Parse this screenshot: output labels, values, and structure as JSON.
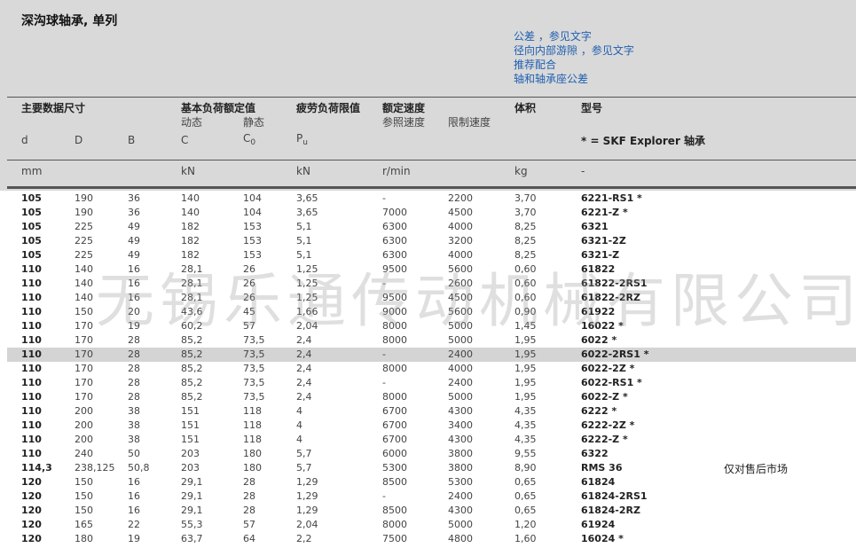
{
  "title": "深沟球轴承, 单列",
  "links": [
    "公差 ，参见文字",
    "径向内部游隙 ，参见文字",
    "推荐配合",
    "轴和轴承座公差"
  ],
  "header": {
    "main_dims": "主要数据尺寸",
    "load_ratings": "基本负荷额定值",
    "dynamic": "动态",
    "static": "静态",
    "fatigue": "疲劳负荷限值",
    "speed_ratings": "额定速度",
    "ref_speed": "参照速度",
    "limit_speed": "限制速度",
    "mass": "体积",
    "designation": "型号",
    "sym_d": "d",
    "sym_D": "D",
    "sym_B": "B",
    "sym_C": "C",
    "sym_C0_base": "C",
    "sym_C0_sub": "0",
    "sym_Pu_base": "P",
    "sym_Pu_sub": "u",
    "explorer_note": "* = SKF Explorer 轴承",
    "unit_mm": "mm",
    "unit_kN_C": "kN",
    "unit_kN_P": "kN",
    "unit_rpm": "r/min",
    "unit_kg": "kg",
    "unit_dash": "-"
  },
  "rows": [
    {
      "d": "105",
      "D": "190",
      "B": "36",
      "C": "140",
      "C0": "104",
      "Pu": "3,65",
      "ref": "-",
      "lim": "2200",
      "mass": "3,70",
      "model": "6221-RS1 *"
    },
    {
      "d": "105",
      "D": "190",
      "B": "36",
      "C": "140",
      "C0": "104",
      "Pu": "3,65",
      "ref": "7000",
      "lim": "4500",
      "mass": "3,70",
      "model": "6221-Z *"
    },
    {
      "d": "105",
      "D": "225",
      "B": "49",
      "C": "182",
      "C0": "153",
      "Pu": "5,1",
      "ref": "6300",
      "lim": "4000",
      "mass": "8,25",
      "model": "6321"
    },
    {
      "d": "105",
      "D": "225",
      "B": "49",
      "C": "182",
      "C0": "153",
      "Pu": "5,1",
      "ref": "6300",
      "lim": "3200",
      "mass": "8,25",
      "model": "6321-2Z"
    },
    {
      "d": "105",
      "D": "225",
      "B": "49",
      "C": "182",
      "C0": "153",
      "Pu": "5,1",
      "ref": "6300",
      "lim": "4000",
      "mass": "8,25",
      "model": "6321-Z"
    },
    {
      "d": "110",
      "D": "140",
      "B": "16",
      "C": "28,1",
      "C0": "26",
      "Pu": "1,25",
      "ref": "9500",
      "lim": "5600",
      "mass": "0,60",
      "model": "61822"
    },
    {
      "d": "110",
      "D": "140",
      "B": "16",
      "C": "28,1",
      "C0": "26",
      "Pu": "1,25",
      "ref": "-",
      "lim": "2600",
      "mass": "0,60",
      "model": "61822-2RS1"
    },
    {
      "d": "110",
      "D": "140",
      "B": "16",
      "C": "28,1",
      "C0": "26",
      "Pu": "1,25",
      "ref": "9500",
      "lim": "4500",
      "mass": "0,60",
      "model": "61822-2RZ"
    },
    {
      "d": "110",
      "D": "150",
      "B": "20",
      "C": "43,6",
      "C0": "45",
      "Pu": "1,66",
      "ref": "9000",
      "lim": "5600",
      "mass": "0,90",
      "model": "61922"
    },
    {
      "d": "110",
      "D": "170",
      "B": "19",
      "C": "60,2",
      "C0": "57",
      "Pu": "2,04",
      "ref": "8000",
      "lim": "5000",
      "mass": "1,45",
      "model": "16022 *"
    },
    {
      "d": "110",
      "D": "170",
      "B": "28",
      "C": "85,2",
      "C0": "73,5",
      "Pu": "2,4",
      "ref": "8000",
      "lim": "5000",
      "mass": "1,95",
      "model": "6022 *"
    },
    {
      "d": "110",
      "D": "170",
      "B": "28",
      "C": "85,2",
      "C0": "73,5",
      "Pu": "2,4",
      "ref": "-",
      "lim": "2400",
      "mass": "1,95",
      "model": "6022-2RS1 *",
      "highlight": true
    },
    {
      "d": "110",
      "D": "170",
      "B": "28",
      "C": "85,2",
      "C0": "73,5",
      "Pu": "2,4",
      "ref": "8000",
      "lim": "4000",
      "mass": "1,95",
      "model": "6022-2Z *"
    },
    {
      "d": "110",
      "D": "170",
      "B": "28",
      "C": "85,2",
      "C0": "73,5",
      "Pu": "2,4",
      "ref": "-",
      "lim": "2400",
      "mass": "1,95",
      "model": "6022-RS1 *"
    },
    {
      "d": "110",
      "D": "170",
      "B": "28",
      "C": "85,2",
      "C0": "73,5",
      "Pu": "2,4",
      "ref": "8000",
      "lim": "5000",
      "mass": "1,95",
      "model": "6022-Z *"
    },
    {
      "d": "110",
      "D": "200",
      "B": "38",
      "C": "151",
      "C0": "118",
      "Pu": "4",
      "ref": "6700",
      "lim": "4300",
      "mass": "4,35",
      "model": "6222 *"
    },
    {
      "d": "110",
      "D": "200",
      "B": "38",
      "C": "151",
      "C0": "118",
      "Pu": "4",
      "ref": "6700",
      "lim": "3400",
      "mass": "4,35",
      "model": "6222-2Z *"
    },
    {
      "d": "110",
      "D": "200",
      "B": "38",
      "C": "151",
      "C0": "118",
      "Pu": "4",
      "ref": "6700",
      "lim": "4300",
      "mass": "4,35",
      "model": "6222-Z *"
    },
    {
      "d": "110",
      "D": "240",
      "B": "50",
      "C": "203",
      "C0": "180",
      "Pu": "5,7",
      "ref": "6000",
      "lim": "3800",
      "mass": "9,55",
      "model": "6322"
    },
    {
      "d": "114,3",
      "D": "238,125",
      "B": "50,8",
      "C": "203",
      "C0": "180",
      "Pu": "5,7",
      "ref": "5300",
      "lim": "3800",
      "mass": "8,90",
      "model": "RMS 36"
    },
    {
      "d": "120",
      "D": "150",
      "B": "16",
      "C": "29,1",
      "C0": "28",
      "Pu": "1,29",
      "ref": "8500",
      "lim": "5300",
      "mass": "0,65",
      "model": "61824"
    },
    {
      "d": "120",
      "D": "150",
      "B": "16",
      "C": "29,1",
      "C0": "28",
      "Pu": "1,29",
      "ref": "-",
      "lim": "2400",
      "mass": "0,65",
      "model": "61824-2RS1"
    },
    {
      "d": "120",
      "D": "150",
      "B": "16",
      "C": "29,1",
      "C0": "28",
      "Pu": "1,29",
      "ref": "8500",
      "lim": "4300",
      "mass": "0,65",
      "model": "61824-2RZ"
    },
    {
      "d": "120",
      "D": "165",
      "B": "22",
      "C": "55,3",
      "C0": "57",
      "Pu": "2,04",
      "ref": "8000",
      "lim": "5000",
      "mass": "1,20",
      "model": "61924"
    },
    {
      "d": "120",
      "D": "180",
      "B": "19",
      "C": "63,7",
      "C0": "64",
      "Pu": "2,2",
      "ref": "7500",
      "lim": "4800",
      "mass": "1,60",
      "model": "16024 *"
    }
  ],
  "watermark": "无锡乐通传动机械有限公司",
  "side_note": "仅对售后市场",
  "colors": {
    "band": "#d9d9d9",
    "link": "#1f5fb0",
    "highlight_row": "#d4d4d4"
  }
}
